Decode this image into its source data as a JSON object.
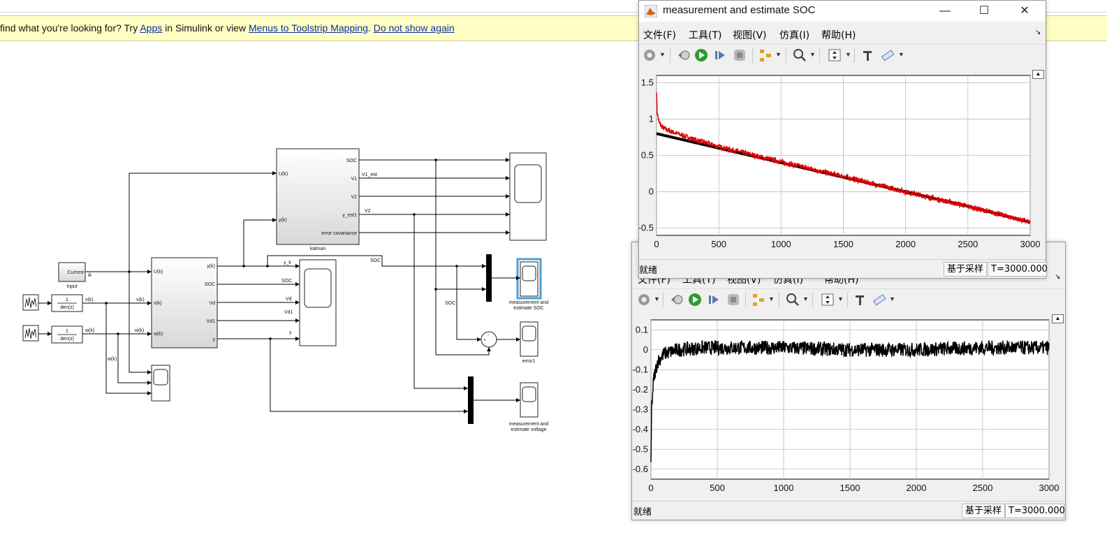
{
  "notification": {
    "prefix": "find what you're looking for? Try ",
    "apps_link": "Apps",
    "middle": " in Simulink or view ",
    "menus_link": "Menus to Toolstrip Mapping",
    "sep": ". ",
    "dismiss_link": "Do not show again"
  },
  "diagram": {
    "current_label": "Current",
    "input_label": "Input",
    "ik_label": "ik",
    "tf_num": "1",
    "tf_den": "den(z)",
    "vk_label": "v(k)",
    "wk_label": "w(k)",
    "kalman_label": "kalman",
    "kalman_inputs": [
      "U(k)",
      "y(k)"
    ],
    "kalman_outputs": [
      "SOC",
      "V1",
      "V2",
      "y_est1",
      "error covariance"
    ],
    "v1_est_label": "V1_est",
    "v2_label": "V2",
    "plant_inputs": [
      "U(k)",
      "v(k)",
      "w(k)"
    ],
    "plant_outputs": [
      "y(k)",
      "SOC",
      "Vd",
      "Vd1",
      "y"
    ],
    "mid_scope_inputs": [
      "y_k",
      "SOC",
      "Vd",
      "Vd1",
      "y"
    ],
    "soc_label": "SOC",
    "soc_label2": "SOC",
    "scope_soc_label": [
      "measurement and",
      "estimate SOC"
    ],
    "error_label": "error1",
    "scope_voltage_label": [
      "measurement and",
      "estimate voltage"
    ]
  },
  "scope1": {
    "title": "measurement and  estimate SOC",
    "menu": [
      "文件(F)",
      "工具(T)",
      "视图(V)",
      "仿真(I)",
      "帮助(H)"
    ],
    "status_ready": "就绪",
    "status_mode": "基于采样",
    "status_time": "T=3000.000"
  },
  "scope2": {
    "menu": [
      "文件(F)",
      "工具(T)",
      "视图(V)",
      "仿真(I)",
      "帮助(H)"
    ],
    "status_ready": "就绪",
    "status_mode": "基于采样",
    "status_time": "T=3000.000"
  },
  "toolbar_icons": [
    "settings-icon",
    "step-back-icon",
    "run-icon",
    "step-forward-icon",
    "stop-icon",
    "signal-selector-icon",
    "zoom-icon",
    "autoscale-icon",
    "cursor-measure-icon",
    "highlight-icon"
  ],
  "colors": {
    "measurement": "#000000",
    "estimate": "#e00000",
    "notif_bg": "#ffffc4",
    "link": "#0b2ea8"
  },
  "chart_data": [
    {
      "type": "line",
      "title": "",
      "xlabel": "",
      "ylabel": "",
      "xlim": [
        0,
        3000
      ],
      "ylim": [
        -0.6,
        1.6
      ],
      "xticks": [
        0,
        500,
        1000,
        1500,
        2000,
        2500,
        3000
      ],
      "yticks": [
        -0.5,
        0,
        0.5,
        1,
        1.5
      ],
      "grid": true,
      "series": [
        {
          "color": "#000000",
          "x": [
            0,
            500,
            1000,
            1500,
            2000,
            2500,
            3000
          ],
          "y": [
            0.8,
            0.6,
            0.4,
            0.2,
            0.0,
            -0.2,
            -0.42
          ]
        },
        {
          "color": "#e00000",
          "x": [
            0,
            5,
            20,
            50,
            100,
            300,
            500,
            1000,
            1500,
            2000,
            2500,
            3000
          ],
          "y": [
            1.4,
            1.1,
            0.95,
            0.88,
            0.84,
            0.72,
            0.62,
            0.41,
            0.21,
            0.0,
            -0.2,
            -0.42
          ],
          "noise": 0.02
        }
      ]
    },
    {
      "type": "line",
      "title": "",
      "xlabel": "",
      "ylabel": "",
      "xlim": [
        0,
        3000
      ],
      "ylim": [
        -0.65,
        0.15
      ],
      "xticks": [
        0,
        500,
        1000,
        1500,
        2000,
        2500,
        3000
      ],
      "yticks": [
        0.1,
        0,
        -0.1,
        -0.2,
        -0.3,
        -0.4,
        -0.5,
        -0.6
      ],
      "grid": true,
      "series": [
        {
          "color": "#000000",
          "x": [
            0,
            5,
            20,
            50,
            100,
            200,
            400,
            1000,
            1500,
            2000,
            2500,
            3000
          ],
          "y": [
            -0.6,
            -0.3,
            -0.15,
            -0.06,
            -0.02,
            0.0,
            0.01,
            0.01,
            0.0,
            0.0,
            0.01,
            0.01
          ],
          "noise": 0.02
        }
      ]
    }
  ]
}
